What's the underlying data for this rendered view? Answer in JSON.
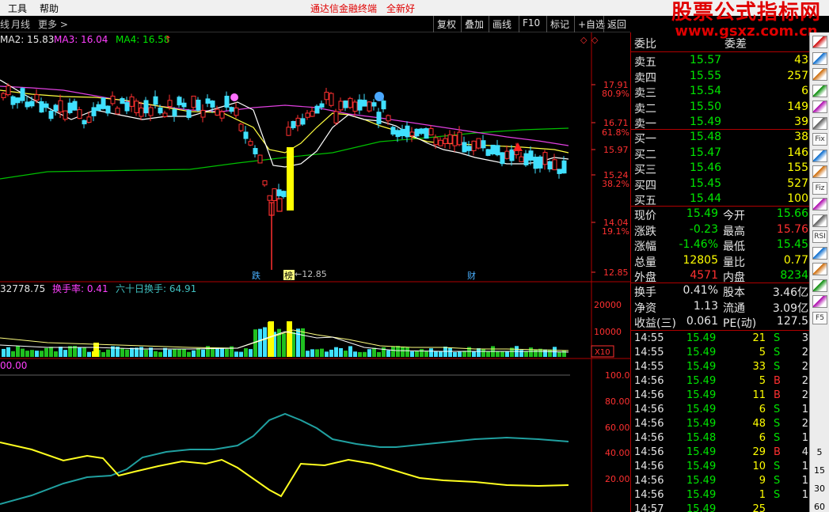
{
  "menubar": {
    "items": [
      "工具",
      "帮助"
    ],
    "notice": [
      "通达信金融终端",
      "全新好"
    ]
  },
  "brand": {
    "name": "股票公式指标网",
    "url": "www.gsxz.com.cn"
  },
  "toolbar": {
    "periods": [
      "线",
      "月线",
      "更多 >"
    ],
    "buttons": [
      "复权",
      "叠加",
      "画线",
      "F10",
      "标记",
      "+自选",
      "返回"
    ]
  },
  "main_chart": {
    "ma_labels": [
      "MA2: 15.83",
      "MA3: 16.04",
      "MA4: 16.58"
    ],
    "price_ticks": [
      "17.91",
      "16.71",
      "15.97",
      "15.24",
      "14.04",
      "12.85"
    ],
    "pct_ticks": [
      "80.9%",
      "61.8%",
      "38.2%",
      "19.1%"
    ],
    "low_label": "←12.85",
    "markers": [
      "跌",
      "榜",
      "财"
    ]
  },
  "volume_chart": {
    "labels": [
      "32778.75",
      "换手率: 0.41",
      "六十日换手: 64.91"
    ],
    "ticks": [
      "20000",
      "10000"
    ],
    "unit": "X10"
  },
  "indicator_chart": {
    "label": "00.00",
    "ticks": [
      "100.0",
      "80.00",
      "60.00",
      "40.00",
      "20.00"
    ]
  },
  "quote": {
    "header": [
      "委比",
      "委差"
    ],
    "asks": [
      {
        "label": "卖五",
        "price": "15.57",
        "vol": "43"
      },
      {
        "label": "卖四",
        "price": "15.55",
        "vol": "257"
      },
      {
        "label": "卖三",
        "price": "15.54",
        "vol": "6"
      },
      {
        "label": "卖二",
        "price": "15.50",
        "vol": "149"
      },
      {
        "label": "卖一",
        "price": "15.49",
        "vol": "39"
      }
    ],
    "bids": [
      {
        "label": "买一",
        "price": "15.48",
        "vol": "38"
      },
      {
        "label": "买二",
        "price": "15.47",
        "vol": "146"
      },
      {
        "label": "买三",
        "price": "15.46",
        "vol": "155"
      },
      {
        "label": "买四",
        "price": "15.45",
        "vol": "527"
      },
      {
        "label": "买五",
        "price": "15.44",
        "vol": "100"
      }
    ],
    "stats": [
      {
        "l1": "现价",
        "v1": "15.49",
        "l2": "今开",
        "v2": "15.66"
      },
      {
        "l1": "涨跌",
        "v1": "-0.23",
        "l2": "最高",
        "v2": "15.76"
      },
      {
        "l1": "涨幅",
        "v1": "-1.46%",
        "l2": "最低",
        "v2": "15.45"
      },
      {
        "l1": "总量",
        "v1": "12805",
        "l2": "量比",
        "v2": "0.77"
      },
      {
        "l1": "外盘",
        "v1": "4571",
        "l2": "内盘",
        "v2": "8234"
      }
    ],
    "stats2": [
      {
        "l1": "换手",
        "v1": "0.41%",
        "l2": "股本",
        "v2": "3.46亿"
      },
      {
        "l1": "净资",
        "v1": "1.13",
        "l2": "流通",
        "v2": "3.09亿"
      },
      {
        "l1": "收益(三)",
        "v1": "0.061",
        "l2": "PE(动)",
        "v2": "127.5"
      }
    ],
    "ticks": [
      {
        "time": "14:55",
        "price": "15.49",
        "vol": "21",
        "side": "S",
        "n": "3"
      },
      {
        "time": "14:55",
        "price": "15.49",
        "vol": "5",
        "side": "S",
        "n": "2"
      },
      {
        "time": "14:55",
        "price": "15.49",
        "vol": "33",
        "side": "S",
        "n": "2"
      },
      {
        "time": "14:56",
        "price": "15.49",
        "vol": "5",
        "side": "B",
        "n": "2"
      },
      {
        "time": "14:56",
        "price": "15.49",
        "vol": "11",
        "side": "B",
        "n": "2"
      },
      {
        "time": "14:56",
        "price": "15.49",
        "vol": "6",
        "side": "S",
        "n": "1"
      },
      {
        "time": "14:56",
        "price": "15.49",
        "vol": "48",
        "side": "S",
        "n": "2"
      },
      {
        "time": "14:56",
        "price": "15.48",
        "vol": "6",
        "side": "S",
        "n": "1"
      },
      {
        "time": "14:56",
        "price": "15.49",
        "vol": "29",
        "side": "B",
        "n": "4"
      },
      {
        "time": "14:56",
        "price": "15.49",
        "vol": "10",
        "side": "S",
        "n": "1"
      },
      {
        "time": "14:56",
        "price": "15.49",
        "vol": "9",
        "side": "S",
        "n": "1"
      },
      {
        "time": "14:56",
        "price": "15.49",
        "vol": "1",
        "side": "S",
        "n": "1"
      },
      {
        "time": "14:57",
        "price": "15.49",
        "vol": "25",
        "side": "",
        "n": ""
      }
    ]
  },
  "sidebar": {
    "icons": [
      "arrow-up-icon",
      "candle-icon",
      "grid-icon",
      "chart-icon",
      "bars-icon",
      "book-icon",
      "fix-icon",
      "folder-icon",
      "pin-icon",
      "fiz-icon",
      "split-icon",
      "arrows-icon",
      "rsi-icon",
      "win-icon",
      "compass-icon",
      "pencil-icon",
      "back-icon",
      "f5-icon"
    ],
    "icon_text": [
      "",
      "",
      "",
      "",
      "",
      "",
      "Fix",
      "",
      "",
      "Fiz",
      "",
      "",
      "RSI",
      "",
      "",
      "",
      "",
      "F5"
    ],
    "numbers": [
      "5",
      "15",
      "30",
      "60"
    ]
  }
}
